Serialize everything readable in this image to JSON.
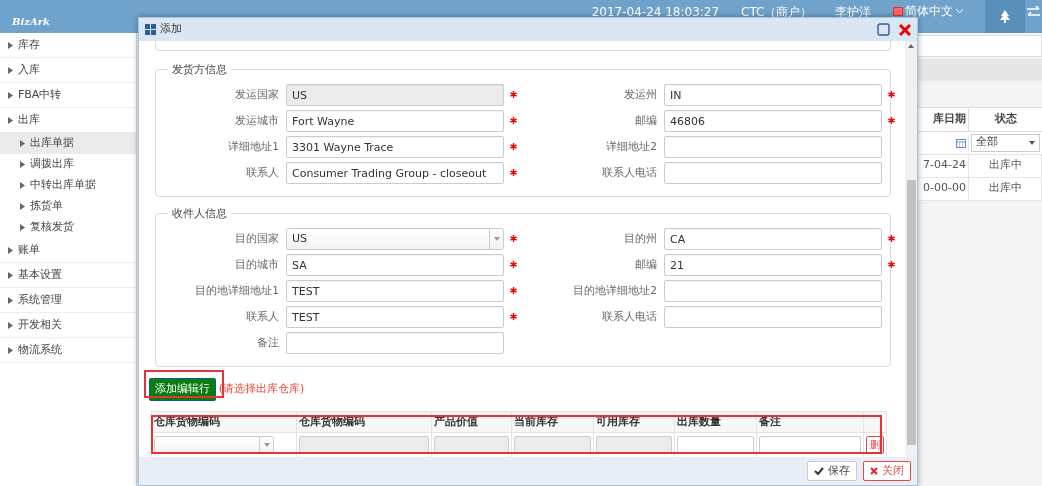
{
  "header": {
    "logo": "BizArk",
    "datetime": "2017-04-24 18:03:27",
    "merchant": "CTC（商户）",
    "user": "李护洋",
    "language": "简体中文"
  },
  "sidebar": {
    "items": [
      {
        "label": "库存",
        "selected": false
      },
      {
        "label": "入库",
        "selected": false
      },
      {
        "label": "FBA中转",
        "selected": false
      },
      {
        "label": "出库",
        "selected": false,
        "children": [
          {
            "label": "出库单据",
            "selected": true
          },
          {
            "label": "调拨出库",
            "selected": false
          },
          {
            "label": "中转出库单据",
            "selected": false
          },
          {
            "label": "拣货单",
            "selected": false
          },
          {
            "label": "复核发货",
            "selected": false
          }
        ]
      },
      {
        "label": "账单",
        "selected": false
      },
      {
        "label": "基本设置",
        "selected": false
      },
      {
        "label": "系统管理",
        "selected": false
      },
      {
        "label": "开发相关",
        "selected": false
      },
      {
        "label": "物流系统",
        "selected": false
      }
    ]
  },
  "background_grid": {
    "columns": [
      "库日期",
      "状态"
    ],
    "status_filter": "全部",
    "rows": [
      [
        "7-04-24",
        "出库中"
      ],
      [
        "0-00-00",
        "出库中"
      ]
    ]
  },
  "modal": {
    "title": "添加",
    "sections": [
      {
        "legend": "发货方信息",
        "fields": [
          {
            "label": "发运国家",
            "value": "US",
            "kind": "readonly",
            "required": true
          },
          {
            "label": "发运州",
            "value": "IN",
            "kind": "input",
            "required": true
          },
          {
            "label": "发运城市",
            "value": "Fort Wayne",
            "kind": "input",
            "required": true
          },
          {
            "label": "邮编",
            "value": "46806",
            "kind": "input",
            "required": true
          },
          {
            "label": "详细地址1",
            "value": "3301 Wayne Trace",
            "kind": "input",
            "required": true
          },
          {
            "label": "详细地址2",
            "kind": "input",
            "required": false
          },
          {
            "label": "联系人",
            "value": "Consumer Trading Group - closeout",
            "kind": "input",
            "required": true
          },
          {
            "label": "联系人电话",
            "kind": "input",
            "required": false
          }
        ]
      },
      {
        "legend": "收件人信息",
        "fields": [
          {
            "label": "目的国家",
            "value": "US",
            "kind": "select",
            "required": true
          },
          {
            "label": "目的州",
            "value": "CA",
            "kind": "input",
            "required": true
          },
          {
            "label": "目的城市",
            "value": "SA",
            "kind": "input",
            "required": true
          },
          {
            "label": "邮编",
            "value": "21",
            "kind": "input",
            "required": true
          },
          {
            "label": "目的地详细地址1",
            "value": "TEST",
            "kind": "input",
            "required": true
          },
          {
            "label": "目的地详细地址2",
            "kind": "input",
            "required": false
          },
          {
            "label": "联系人",
            "value": "TEST",
            "kind": "input",
            "required": true
          },
          {
            "label": "联系人电话",
            "kind": "input",
            "required": false
          },
          {
            "label": "备注",
            "kind": "input",
            "required": false
          }
        ]
      }
    ],
    "add_row_button": "添加编辑行",
    "hint": "(请选择出库仓库)",
    "table": {
      "columns": [
        {
          "label": "仓库货物编码",
          "kind": "select"
        },
        {
          "label": "仓库货物编码",
          "kind": "readonly"
        },
        {
          "label": "产品价值",
          "kind": "readonly"
        },
        {
          "label": "当前库存",
          "kind": "readonly"
        },
        {
          "label": "可用库存",
          "kind": "readonly"
        },
        {
          "label": "出库数量",
          "kind": "input"
        },
        {
          "label": "备注",
          "kind": "input"
        }
      ],
      "delete_button": "删"
    },
    "footer_buttons": [
      {
        "label": "保存",
        "kind": "save"
      },
      {
        "label": "关闭",
        "kind": "close"
      }
    ]
  }
}
